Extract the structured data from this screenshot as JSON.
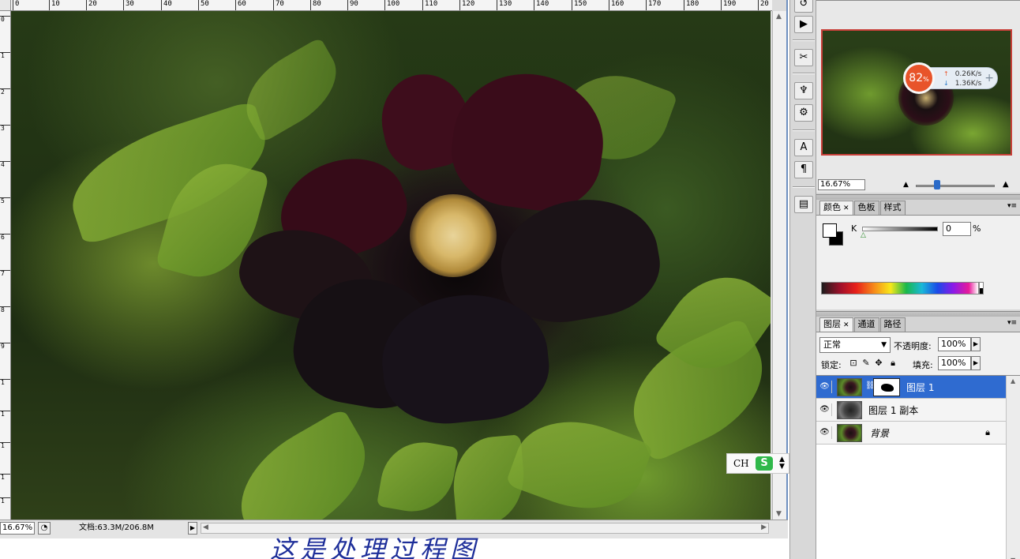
{
  "ruler": {
    "top_ticks": [
      "0",
      "10",
      "20",
      "30",
      "40",
      "50",
      "60",
      "70",
      "80",
      "90",
      "100",
      "110",
      "120",
      "130",
      "140",
      "150",
      "160",
      "170",
      "180",
      "190",
      "20"
    ],
    "left_ticks": [
      "0",
      "1",
      "2",
      "3",
      "4",
      "5",
      "6",
      "7",
      "8",
      "9",
      "1",
      "1",
      "1",
      "1",
      "1",
      "1"
    ]
  },
  "document": {
    "zoom": "16.67%",
    "info": "文档:63.3M/206.8M"
  },
  "ime": {
    "label": "CH",
    "logo": "S"
  },
  "caption": "这是处理过程图",
  "navigator": {
    "zoom": "16.67%",
    "zoom_fraction": 0.27
  },
  "net_widget": {
    "percent": "82",
    "unit": "%",
    "upload": "0.26K/s",
    "download": "1.36K/s"
  },
  "color_panel": {
    "tabs": [
      {
        "label": "颜色",
        "closable": true
      },
      {
        "label": "色板",
        "closable": false
      },
      {
        "label": "样式",
        "closable": false
      }
    ],
    "channel": "K",
    "value": "0",
    "unit": "%",
    "foreground": "#ffffff",
    "background": "#000000"
  },
  "layers_panel": {
    "tabs": [
      {
        "label": "图层",
        "closable": true
      },
      {
        "label": "通道",
        "closable": false
      },
      {
        "label": "路径",
        "closable": false
      }
    ],
    "blend_mode": "正常",
    "opacity_label": "不透明度:",
    "opacity": "100%",
    "lock_label": "锁定:",
    "fill_label": "填充:",
    "fill": "100%",
    "layers": [
      {
        "name": "图层 1",
        "selected": true,
        "has_mask": true,
        "locked": false
      },
      {
        "name": "图层 1 副本",
        "selected": false,
        "has_mask": false,
        "locked": false
      },
      {
        "name": "背景",
        "selected": false,
        "has_mask": false,
        "locked": true
      }
    ]
  },
  "colors": {
    "selection": "#2f6bd0",
    "navigator_frame": "#c8403a",
    "caption": "#1e2f9a"
  },
  "icons": {
    "eye": "eye-icon",
    "lock": "lock-icon",
    "chain": "link-icon"
  }
}
